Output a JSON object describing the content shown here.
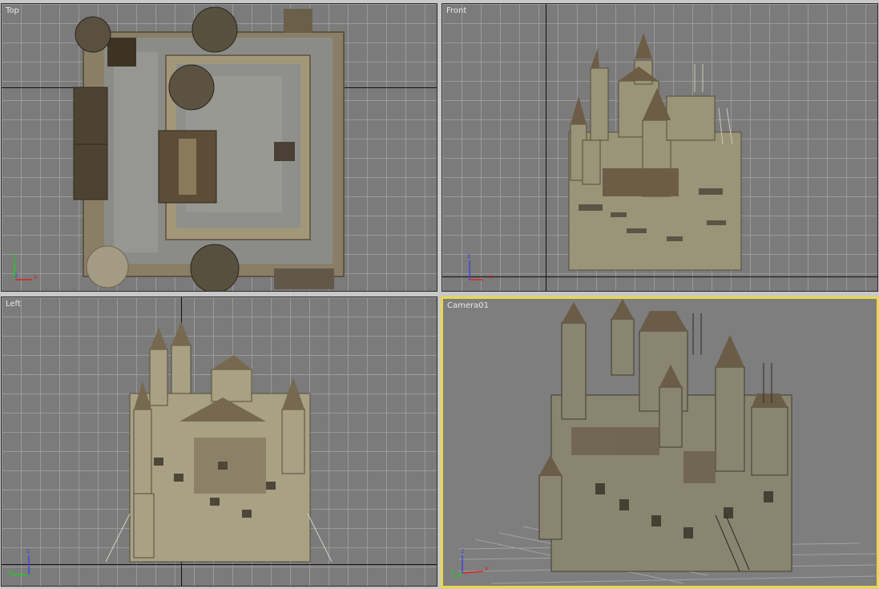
{
  "viewports": {
    "top": {
      "label": "Top"
    },
    "front": {
      "label": "Front"
    },
    "left": {
      "label": "Left"
    },
    "camera": {
      "label": "Camera01",
      "active": true
    }
  },
  "gizmo": {
    "x": "x",
    "y": "y",
    "z": "z"
  },
  "colors": {
    "viewport_bg": "#7b7b7b",
    "grid": "#9a9a9a",
    "active_border": "#e8d84a",
    "axis_x": "#d22",
    "axis_y": "#2c2",
    "axis_z": "#44d"
  }
}
